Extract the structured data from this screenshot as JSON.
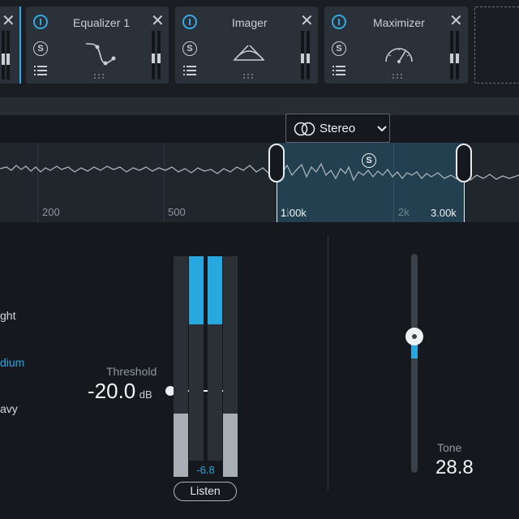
{
  "modules": [
    {
      "title": "",
      "solo": "S"
    },
    {
      "title": "Equalizer 1",
      "solo": "S",
      "icon": "eq-curve-icon"
    },
    {
      "title": "Imager",
      "solo": "S",
      "icon": "stereo-width-icon"
    },
    {
      "title": "Maximizer",
      "solo": "S",
      "icon": "gauge-icon"
    }
  ],
  "stereo_mode": "Stereo",
  "band_solo": "S",
  "spectrum": {
    "freq_labels": [
      "200",
      "500",
      "1k",
      "2k"
    ],
    "band_low": "1.00k",
    "band_high": "3.00k"
  },
  "modes": [
    "ght",
    "dium",
    "avy"
  ],
  "threshold": {
    "label": "Threshold",
    "value": "-20.0",
    "unit": "dB"
  },
  "gain_reduction": "-6.8",
  "listen_label": "Listen",
  "tone": {
    "label": "Tone",
    "value": "28.8",
    "slider_fraction": 0.62
  },
  "colors": {
    "accent": "#29a8e0",
    "background": "#15191d",
    "module": "#2a3138"
  }
}
